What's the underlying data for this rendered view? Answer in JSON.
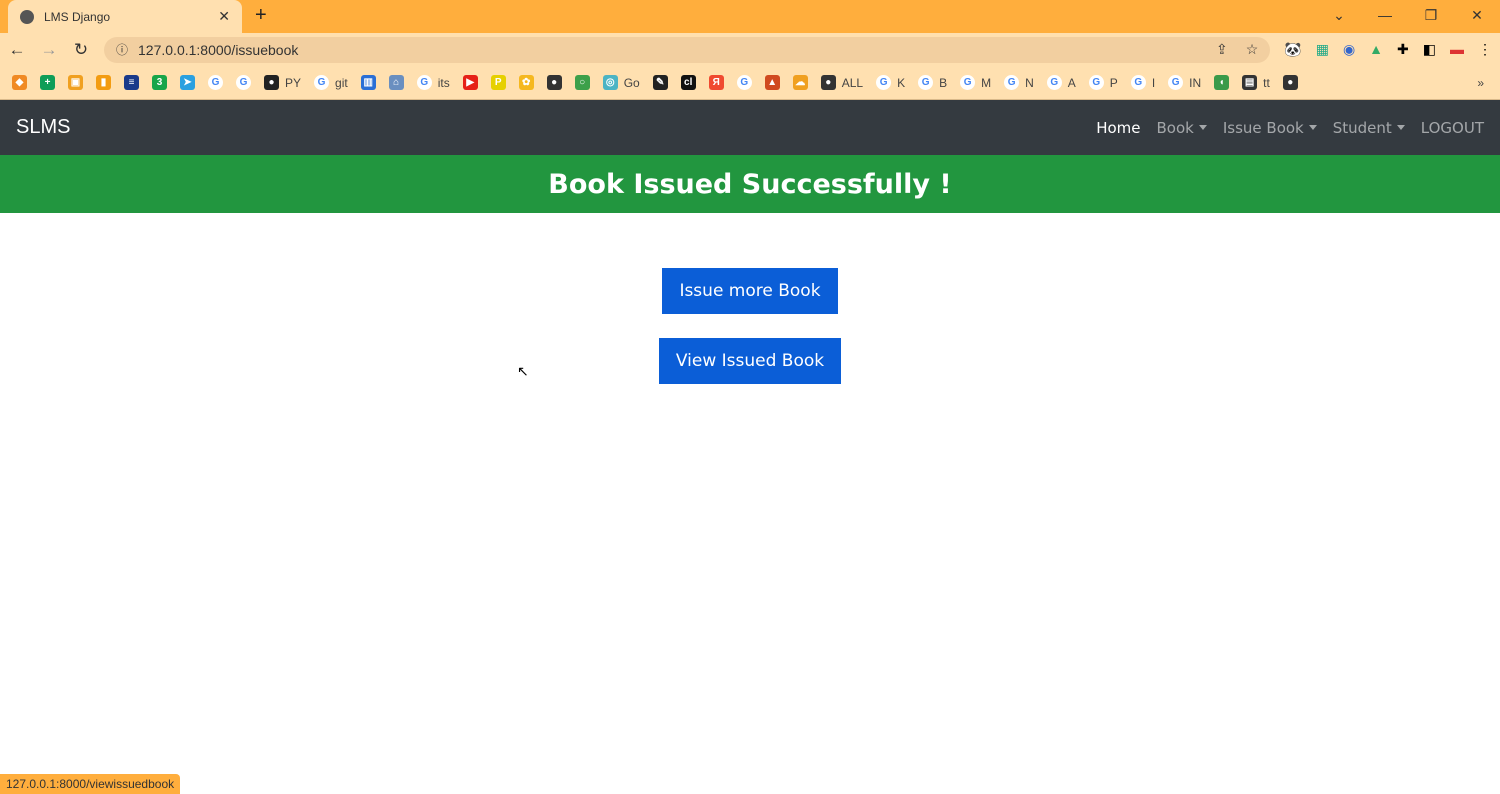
{
  "browser": {
    "tab_title": "LMS Django",
    "url": "127.0.0.1:8000/issuebook",
    "status_url": "127.0.0.1:8000/viewissuedbook",
    "bookmarks": [
      {
        "label": "",
        "glyph": "◆",
        "color": "#f08a24"
      },
      {
        "label": "",
        "glyph": "+",
        "color": "#0f9d58"
      },
      {
        "label": "",
        "glyph": "▣",
        "color": "#f0a020"
      },
      {
        "label": "",
        "glyph": "▮",
        "color": "#f39c12"
      },
      {
        "label": "",
        "glyph": "≡",
        "color": "#1a3a8a"
      },
      {
        "label": "",
        "glyph": "3",
        "color": "#18a54a"
      },
      {
        "label": "",
        "glyph": "➤",
        "color": "#2aa0e0"
      },
      {
        "label": "",
        "glyph": "G",
        "color": "#4285f4"
      },
      {
        "label": "",
        "glyph": "G",
        "color": "#4285f4"
      },
      {
        "label": "PY",
        "glyph": "●",
        "color": "#222"
      },
      {
        "label": "git",
        "glyph": "G",
        "color": "#4285f4"
      },
      {
        "label": "",
        "glyph": "▥",
        "color": "#2a6fd6"
      },
      {
        "label": "",
        "glyph": "⌂",
        "color": "#6a8fc0"
      },
      {
        "label": "its",
        "glyph": "G",
        "color": "#4285f4"
      },
      {
        "label": "",
        "glyph": "▶",
        "color": "#e62117"
      },
      {
        "label": "",
        "glyph": "P",
        "color": "#e6d000"
      },
      {
        "label": "",
        "glyph": "✿",
        "color": "#f5b820"
      },
      {
        "label": "",
        "glyph": "●",
        "color": "#333"
      },
      {
        "label": "",
        "glyph": "○",
        "color": "#3da04a"
      },
      {
        "label": "Go",
        "glyph": "◎",
        "color": "#4cb4c4"
      },
      {
        "label": "",
        "glyph": "✎",
        "color": "#222"
      },
      {
        "label": "",
        "glyph": "cl",
        "color": "#111"
      },
      {
        "label": "",
        "glyph": "Я",
        "color": "#f04a30"
      },
      {
        "label": "",
        "glyph": "G",
        "color": "#4285f4"
      },
      {
        "label": "",
        "glyph": "▲",
        "color": "#d04a20"
      },
      {
        "label": "",
        "glyph": "☁",
        "color": "#f0a020"
      },
      {
        "label": "ALL",
        "glyph": "●",
        "color": "#333"
      },
      {
        "label": "K",
        "glyph": "G",
        "color": "#4285f4"
      },
      {
        "label": "B",
        "glyph": "G",
        "color": "#4285f4"
      },
      {
        "label": "M",
        "glyph": "G",
        "color": "#4285f4"
      },
      {
        "label": "N",
        "glyph": "G",
        "color": "#4285f4"
      },
      {
        "label": "A",
        "glyph": "G",
        "color": "#4285f4"
      },
      {
        "label": "P",
        "glyph": "G",
        "color": "#4285f4"
      },
      {
        "label": "I",
        "glyph": "G",
        "color": "#4285f4"
      },
      {
        "label": "IN",
        "glyph": "G",
        "color": "#4285f4"
      },
      {
        "label": "",
        "glyph": "◖",
        "color": "#3a9a4a"
      },
      {
        "label": "tt",
        "glyph": "▤",
        "color": "#333"
      },
      {
        "label": "",
        "glyph": "●",
        "color": "#333"
      }
    ],
    "more": "»"
  },
  "navbar": {
    "brand": "SLMS",
    "home": "Home",
    "book": "Book",
    "issue_book": "Issue Book",
    "student": "Student",
    "logout": "LOGOUT"
  },
  "banner": "Book Issued Successfully !",
  "buttons": {
    "issue_more": "Issue more Book",
    "view_issued": "View Issued Book"
  },
  "colors": {
    "navbar": "#343a40",
    "banner": "#22963f",
    "button": "#0b5ed7"
  }
}
